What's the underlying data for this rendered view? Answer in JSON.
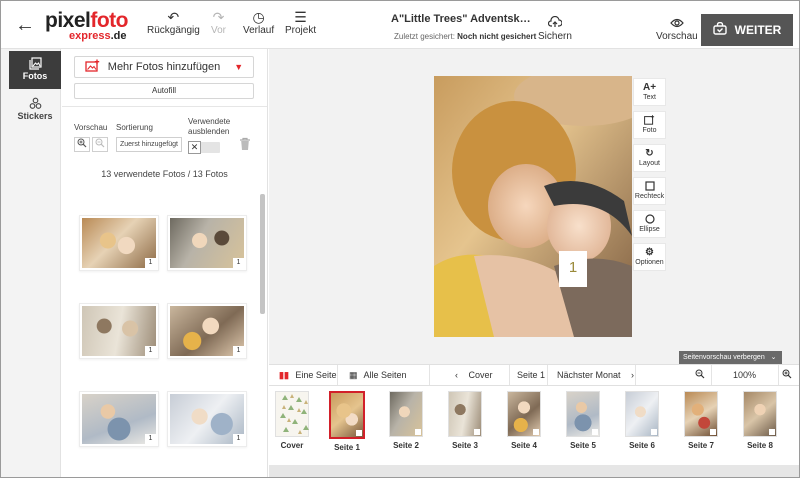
{
  "header": {
    "logo_part1": "pixel",
    "logo_part2": "foto",
    "logo_part3": "express",
    "logo_part4": ".de",
    "undo_label": "Rückgängig",
    "redo_label": "Vor",
    "history_label": "Verlauf",
    "project_label": "Projekt",
    "project_title": "A\"Little Trees\" Adventskalender ...",
    "saved_prefix": "Zuletzt gesichert:",
    "saved_value": "Noch nicht gesichert",
    "save_label": "Sichern",
    "preview_label": "Vorschau",
    "next_label": "WEITER"
  },
  "rail": {
    "photos_label": "Fotos",
    "stickers_label": "Stickers"
  },
  "photos_panel": {
    "add_photos_label": "Mehr Fotos hinzufügen",
    "autofill_label": "Autofill",
    "preview_label": "Vorschau",
    "sort_label": "Sortierung",
    "hide_used_label_1": "Verwendete",
    "hide_used_label_2": "ausblenden",
    "sort_value": "Zuerst hinzugefügt",
    "count_text": "13 verwendete Fotos / 13 Fotos",
    "thumbnails": [
      {
        "badge": "1"
      },
      {
        "badge": "1"
      },
      {
        "badge": "1"
      },
      {
        "badge": "1"
      },
      {
        "badge": "1"
      },
      {
        "badge": "1"
      }
    ]
  },
  "canvas": {
    "page_number": "1",
    "tools": [
      {
        "icon": "text-add-icon",
        "label": "Text"
      },
      {
        "icon": "photo-add-icon",
        "label": "Foto"
      },
      {
        "icon": "layout-icon",
        "label": "Layout"
      },
      {
        "icon": "rectangle-icon",
        "label": "Rechteck"
      },
      {
        "icon": "ellipse-icon",
        "label": "Ellipse"
      },
      {
        "icon": "gear-icon",
        "label": "Optionen"
      }
    ]
  },
  "nav": {
    "single_page_label": "Eine Seite",
    "all_pages_label": "Alle Seiten",
    "prev_label": "Cover",
    "current_label": "Seite 1",
    "next_label": "Nächster Monat",
    "zoom_value": "100%",
    "hide_preview_label": "Seitenvorschau verbergen"
  },
  "pages": [
    {
      "label": "Cover"
    },
    {
      "label": "Seite 1"
    },
    {
      "label": "Seite 2"
    },
    {
      "label": "Seite 3"
    },
    {
      "label": "Seite 4"
    },
    {
      "label": "Seite 5"
    },
    {
      "label": "Seite 6"
    },
    {
      "label": "Seite 7"
    },
    {
      "label": "Seite 8"
    }
  ],
  "colors": {
    "brand_red": "#e3262b",
    "selected_border": "#d2202a",
    "next_button": "#555555",
    "rail_active": "#3c3c3c"
  }
}
